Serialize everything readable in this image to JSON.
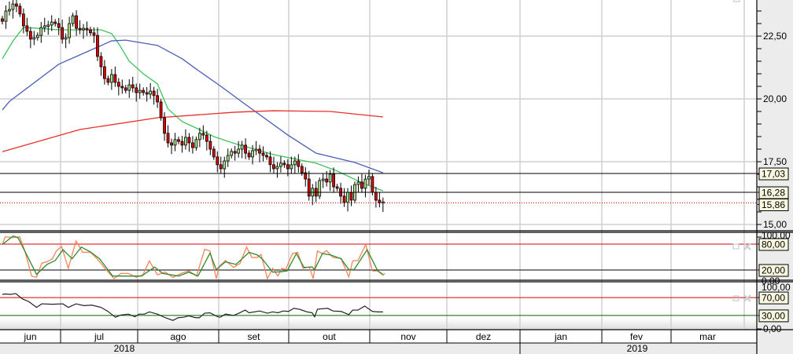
{
  "chart_data": {
    "type": "candlestick",
    "price_axis": {
      "min": 14.5,
      "max": 24.0,
      "tick_labels": [
        "22,50",
        "20,00",
        "17,50",
        "15,00"
      ],
      "tick_values": [
        22.5,
        20.0,
        17.5,
        15.0
      ]
    },
    "closes": [
      23.09,
      23.5,
      23.56,
      23.78,
      23.69,
      23.38,
      22.91,
      22.69,
      22.38,
      22.44,
      22.53,
      22.84,
      22.91,
      22.94,
      23.06,
      23.0,
      22.84,
      22.38,
      22.44,
      23.0,
      23.31,
      22.81,
      22.75,
      22.81,
      22.75,
      22.63,
      22.53,
      21.69,
      21.28,
      20.81,
      20.66,
      20.97,
      20.66,
      20.5,
      20.44,
      20.34,
      20.56,
      20.44,
      20.25,
      20.34,
      20.25,
      20.19,
      20.31,
      20.13,
      19.88,
      19.25,
      18.63,
      18.25,
      18.16,
      18.38,
      18.31,
      18.16,
      18.47,
      18.25,
      18.06,
      18.38,
      18.63,
      18.56,
      18.31,
      18.0,
      17.69,
      17.38,
      17.22,
      17.53,
      17.75,
      17.91,
      17.84,
      18.0,
      18.16,
      17.84,
      17.69,
      17.94,
      18.0,
      17.84,
      17.75,
      17.69,
      17.38,
      17.22,
      17.31,
      17.44,
      17.38,
      17.22,
      17.38,
      17.53,
      17.31,
      17.06,
      16.81,
      16.13,
      16.44,
      16.13,
      16.75,
      16.81,
      16.69,
      17.0,
      16.5,
      16.44,
      16.13,
      15.88,
      16.28,
      15.97,
      16.59,
      16.69,
      16.44,
      16.81,
      16.91,
      16.28,
      15.97,
      15.86,
      15.9
    ],
    "moving_averages": [
      {
        "name": "short",
        "color": "#3cc35a",
        "points": [
          [
            0,
            21.6
          ],
          [
            3,
            22.3
          ],
          [
            6,
            22.85
          ],
          [
            16,
            22.75
          ],
          [
            28,
            22.75
          ],
          [
            31,
            22.6
          ],
          [
            33,
            22.2
          ],
          [
            36,
            21.5
          ],
          [
            40,
            21.0
          ],
          [
            44,
            20.6
          ],
          [
            47,
            19.6
          ],
          [
            51,
            19.1
          ],
          [
            55,
            18.84
          ],
          [
            60,
            18.5
          ],
          [
            66,
            18.22
          ],
          [
            77,
            17.78
          ],
          [
            89,
            17.44
          ],
          [
            95,
            17.13
          ],
          [
            102,
            16.66
          ],
          [
            108,
            16.34
          ]
        ]
      },
      {
        "name": "medium",
        "color": "#4a5fb8",
        "points": [
          [
            0,
            19.56
          ],
          [
            2,
            19.9
          ],
          [
            16,
            21.38
          ],
          [
            31,
            22.31
          ],
          [
            35,
            22.34
          ],
          [
            44,
            22.13
          ],
          [
            51,
            21.6
          ],
          [
            55,
            21.19
          ],
          [
            62,
            20.5
          ],
          [
            68,
            19.88
          ],
          [
            81,
            18.56
          ],
          [
            89,
            17.84
          ],
          [
            100,
            17.47
          ],
          [
            108,
            17.06
          ]
        ]
      },
      {
        "name": "long",
        "color": "#e8302a",
        "points": [
          [
            0,
            17.9
          ],
          [
            22,
            18.78
          ],
          [
            44,
            19.25
          ],
          [
            66,
            19.47
          ],
          [
            77,
            19.53
          ],
          [
            93,
            19.5
          ],
          [
            108,
            19.28
          ]
        ]
      }
    ],
    "price_levels": [
      {
        "value": 17.03,
        "label": "17,03",
        "style": "solid"
      },
      {
        "value": 16.28,
        "label": "16,28",
        "style": "solid"
      },
      {
        "value": 15.86,
        "label": "15,86",
        "style": "dotted"
      }
    ],
    "stochastic": {
      "range": [
        0,
        100
      ],
      "axis_labels": [
        "100,00",
        "0,00"
      ],
      "levels": [
        {
          "value": 80,
          "label": "80,00",
          "color": "#e00000"
        },
        {
          "value": 20,
          "label": "20,00",
          "color": "#000000"
        }
      ],
      "k": {
        "color": "#f4845a",
        "points": [
          [
            0,
            79
          ],
          [
            0.8,
            97
          ],
          [
            3.1,
            95
          ],
          [
            4.9,
            97
          ],
          [
            6.4,
            64
          ],
          [
            8.3,
            6
          ],
          [
            9.7,
            3
          ],
          [
            11.2,
            36
          ],
          [
            12.7,
            39
          ],
          [
            14.2,
            46
          ],
          [
            15.3,
            64
          ],
          [
            16.8,
            75
          ],
          [
            18.7,
            24
          ],
          [
            20.9,
            87
          ],
          [
            22.8,
            61
          ],
          [
            25,
            61
          ],
          [
            26.9,
            46
          ],
          [
            29.1,
            24
          ],
          [
            31.7,
            0
          ],
          [
            33.6,
            12
          ],
          [
            35.8,
            12
          ],
          [
            38,
            3
          ],
          [
            39.9,
            9
          ],
          [
            41.7,
            41
          ],
          [
            44,
            9
          ],
          [
            46.2,
            15
          ],
          [
            48.4,
            3
          ],
          [
            50.7,
            12
          ],
          [
            52.9,
            18
          ],
          [
            55.1,
            6
          ],
          [
            57.4,
            68
          ],
          [
            58.9,
            64
          ],
          [
            60.7,
            0
          ],
          [
            61.5,
            28
          ],
          [
            63.3,
            42
          ],
          [
            65.6,
            26
          ],
          [
            67.4,
            35
          ],
          [
            69.3,
            73
          ],
          [
            70.8,
            49
          ],
          [
            72.3,
            49
          ],
          [
            73.4,
            56
          ],
          [
            75.2,
            0
          ],
          [
            76.7,
            24
          ],
          [
            78.2,
            6
          ],
          [
            79.3,
            24
          ],
          [
            80.4,
            21
          ],
          [
            82.3,
            58
          ],
          [
            83.8,
            61
          ],
          [
            85.3,
            24
          ],
          [
            87.1,
            27
          ],
          [
            88.2,
            0
          ],
          [
            89.4,
            64
          ],
          [
            90.8,
            58
          ],
          [
            92,
            65
          ],
          [
            93.8,
            49
          ],
          [
            96.1,
            47
          ],
          [
            98.3,
            4
          ],
          [
            99.4,
            41
          ],
          [
            100.9,
            42
          ],
          [
            103.1,
            79
          ],
          [
            105,
            18
          ],
          [
            106.5,
            18
          ],
          [
            108,
            8
          ],
          [
            108.5,
            12
          ]
        ]
      },
      "d": {
        "color": "#2e8b2e",
        "points": [
          [
            0,
            79
          ],
          [
            3.1,
            99
          ],
          [
            4.5,
            94
          ],
          [
            9.7,
            10
          ],
          [
            12.7,
            33
          ],
          [
            15,
            42
          ],
          [
            17.2,
            67
          ],
          [
            19.8,
            46
          ],
          [
            22.4,
            73
          ],
          [
            25,
            62
          ],
          [
            27.6,
            46
          ],
          [
            31.3,
            6
          ],
          [
            36.5,
            6
          ],
          [
            39.5,
            6
          ],
          [
            43.2,
            27
          ],
          [
            45.5,
            12
          ],
          [
            50,
            6
          ],
          [
            52.9,
            15
          ],
          [
            55.5,
            6
          ],
          [
            58.9,
            59
          ],
          [
            60.7,
            21
          ],
          [
            63.3,
            39
          ],
          [
            66.3,
            33
          ],
          [
            70,
            61
          ],
          [
            72.3,
            55
          ],
          [
            73.7,
            46
          ],
          [
            76.7,
            15
          ],
          [
            79,
            16
          ],
          [
            80.8,
            18
          ],
          [
            83.4,
            58
          ],
          [
            85.6,
            26
          ],
          [
            87.9,
            27
          ],
          [
            88.6,
            21
          ],
          [
            90.8,
            58
          ],
          [
            93.1,
            55
          ],
          [
            96.1,
            46
          ],
          [
            98.3,
            21
          ],
          [
            99.8,
            21
          ],
          [
            103.5,
            67
          ],
          [
            106.5,
            18
          ],
          [
            108,
            10
          ]
        ]
      }
    },
    "rsi": {
      "range": [
        0,
        100
      ],
      "axis_labels": [
        "100,00",
        "0,00"
      ],
      "levels": [
        {
          "value": 70,
          "label": "70,00",
          "color": "#e00000"
        },
        {
          "value": 30,
          "label": "30,00",
          "color": "#006400"
        }
      ],
      "line": {
        "color": "#222222",
        "points": [
          [
            0,
            77
          ],
          [
            0.8,
            78
          ],
          [
            2.3,
            77
          ],
          [
            3.8,
            79
          ],
          [
            5.7,
            67
          ],
          [
            7.5,
            61
          ],
          [
            9.7,
            48
          ],
          [
            11.2,
            56
          ],
          [
            14.2,
            55
          ],
          [
            17.2,
            56
          ],
          [
            18.7,
            48
          ],
          [
            20.9,
            56
          ],
          [
            23.1,
            52
          ],
          [
            25.4,
            53
          ],
          [
            28,
            48
          ],
          [
            29.8,
            40
          ],
          [
            32.1,
            26
          ],
          [
            33.6,
            31
          ],
          [
            35.8,
            33
          ],
          [
            37.6,
            27
          ],
          [
            38.8,
            33
          ],
          [
            40.3,
            33
          ],
          [
            41.7,
            38
          ],
          [
            44,
            33
          ],
          [
            46.2,
            25
          ],
          [
            48.4,
            19
          ],
          [
            49.9,
            25
          ],
          [
            51.4,
            26
          ],
          [
            52.9,
            29
          ],
          [
            54.8,
            25
          ],
          [
            55.9,
            25
          ],
          [
            57.4,
            35
          ],
          [
            58.9,
            36
          ],
          [
            61.1,
            27
          ],
          [
            61.8,
            26
          ],
          [
            63.3,
            33
          ],
          [
            65.6,
            30
          ],
          [
            67.1,
            35
          ],
          [
            68.9,
            42
          ],
          [
            70,
            36
          ],
          [
            73,
            40
          ],
          [
            75.2,
            35
          ],
          [
            76.7,
            38
          ],
          [
            78.2,
            36
          ],
          [
            79.7,
            40
          ],
          [
            81.2,
            39
          ],
          [
            82.7,
            46
          ],
          [
            84.2,
            44
          ],
          [
            86.4,
            38
          ],
          [
            87.9,
            36
          ],
          [
            88.6,
            27
          ],
          [
            89.4,
            44
          ],
          [
            92.3,
            46
          ],
          [
            93.8,
            40
          ],
          [
            96.1,
            39
          ],
          [
            98.3,
            32
          ],
          [
            99.4,
            42
          ],
          [
            100.9,
            42
          ],
          [
            102.8,
            51
          ],
          [
            105,
            39
          ],
          [
            106.5,
            38
          ],
          [
            108,
            38
          ]
        ]
      }
    },
    "x_axis": {
      "months": [
        "jun",
        "jul",
        "ago",
        "set",
        "out",
        "nov",
        "dez",
        "jan",
        "fev",
        "mar"
      ],
      "years": [
        "2018",
        "2019"
      ]
    },
    "colors": {
      "up": "#a8e08a",
      "down": "#e00000",
      "grid": "#d0d0d0",
      "label_bg": "#f8f8e0"
    }
  }
}
